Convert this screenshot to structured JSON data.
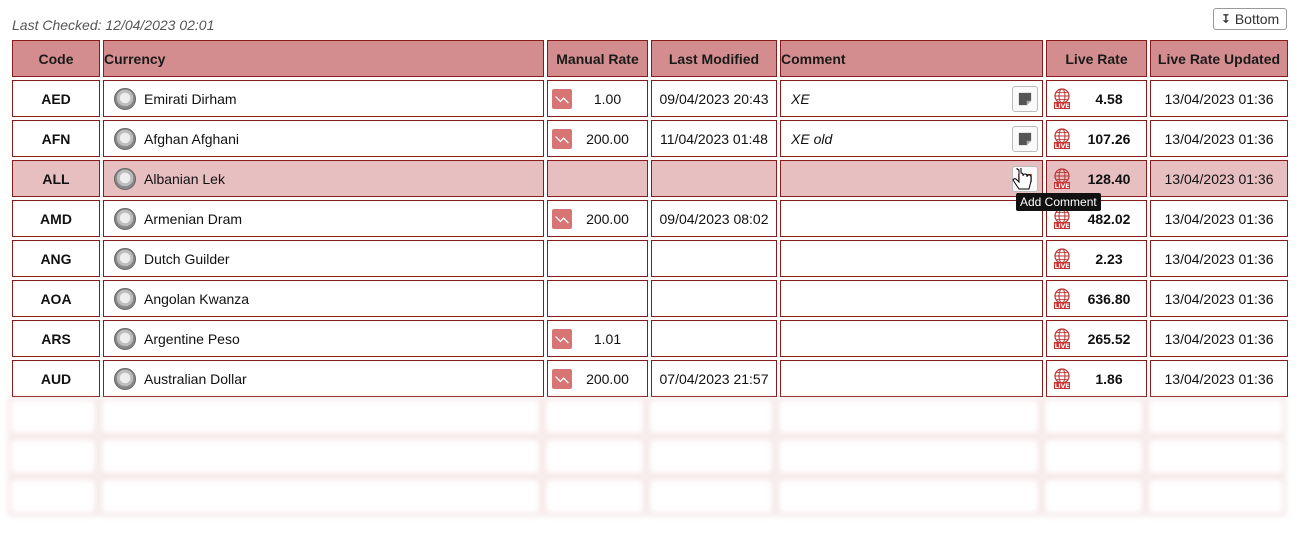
{
  "header": {
    "last_checked": "Last Checked: 12/04/2023 02:01",
    "bottom_button": "Bottom"
  },
  "columns": [
    "Code",
    "Currency",
    "Manual Rate",
    "Last Modified",
    "Comment",
    "Live Rate",
    "Live Rate Updated"
  ],
  "rows": [
    {
      "code": "AED",
      "currency": "Emirati Dirham",
      "manual_rate": "1.00",
      "last_modified": "09/04/2023 20:43",
      "comment": "XE",
      "live_rate": "4.58",
      "live_updated": "13/04/2023 01:36"
    },
    {
      "code": "AFN",
      "currency": "Afghan Afghani",
      "manual_rate": "200.00",
      "last_modified": "11/04/2023 01:48",
      "comment": "XE old",
      "live_rate": "107.26",
      "live_updated": "13/04/2023 01:36"
    },
    {
      "code": "ALL",
      "currency": "Albanian Lek",
      "manual_rate": "",
      "last_modified": "",
      "comment": "",
      "live_rate": "128.40",
      "live_updated": "13/04/2023 01:36"
    },
    {
      "code": "AMD",
      "currency": "Armenian Dram",
      "manual_rate": "200.00",
      "last_modified": "09/04/2023 08:02",
      "comment": "",
      "live_rate": "482.02",
      "live_updated": "13/04/2023 01:36"
    },
    {
      "code": "ANG",
      "currency": "Dutch Guilder",
      "manual_rate": "",
      "last_modified": "",
      "comment": "",
      "live_rate": "2.23",
      "live_updated": "13/04/2023 01:36"
    },
    {
      "code": "AOA",
      "currency": "Angolan Kwanza",
      "manual_rate": "",
      "last_modified": "",
      "comment": "",
      "live_rate": "636.80",
      "live_updated": "13/04/2023 01:36"
    },
    {
      "code": "ARS",
      "currency": "Argentine Peso",
      "manual_rate": "1.01",
      "last_modified": "",
      "comment": "",
      "live_rate": "265.52",
      "live_updated": "13/04/2023 01:36"
    },
    {
      "code": "AUD",
      "currency": "Australian Dollar",
      "manual_rate": "200.00",
      "last_modified": "07/04/2023 21:57",
      "comment": "",
      "live_rate": "1.86",
      "live_updated": "13/04/2023 01:36"
    }
  ],
  "highlighted_row": "ALL",
  "tooltip": "Add Comment",
  "icons": {
    "currency": "coin-stack-icon",
    "manual": "trend-chart-icon",
    "comment": "note-icon",
    "live": "globe-live-icon"
  },
  "colors": {
    "header_bg": "#d48d8f",
    "border": "#8b1a1a",
    "highlight_row": "#e7bfc1",
    "manual_icon": "#d77474"
  }
}
